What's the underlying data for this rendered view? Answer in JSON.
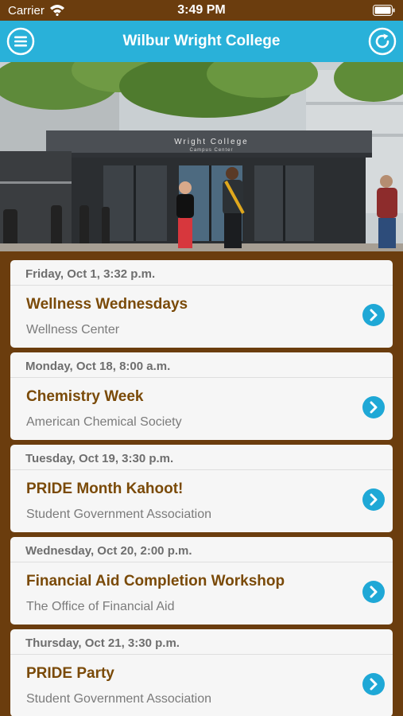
{
  "status_bar": {
    "carrier": "Carrier",
    "time": "3:49 PM"
  },
  "nav": {
    "title": "Wilbur Wright College",
    "menu_icon": "hamburger-menu-icon",
    "refresh_icon": "refresh-icon"
  },
  "hero": {
    "sign_line1": "Wright College",
    "sign_line2": "Campus Center"
  },
  "events": [
    {
      "date": "Friday, Oct 1, 3:32 p.m.",
      "name": "Wellness Wednesdays",
      "org": "Wellness Center"
    },
    {
      "date": "Monday, Oct 18, 8:00 a.m.",
      "name": "Chemistry Week",
      "org": "American Chemical Society"
    },
    {
      "date": "Tuesday, Oct 19, 3:30 p.m.",
      "name": "PRIDE Month Kahoot!",
      "org": "Student Government Association"
    },
    {
      "date": "Wednesday, Oct 20, 2:00 p.m.",
      "name": "Financial Aid Completion Workshop",
      "org": "The Office of Financial Aid"
    },
    {
      "date": "Thursday, Oct 21, 3:30 p.m.",
      "name": "PRIDE Party",
      "org": "Student Government Association"
    }
  ],
  "colors": {
    "nav_bar": "#29b1d9",
    "background": "#6b3d0e",
    "event_title": "#7a4a08",
    "chevron": "#1fa8d6"
  }
}
